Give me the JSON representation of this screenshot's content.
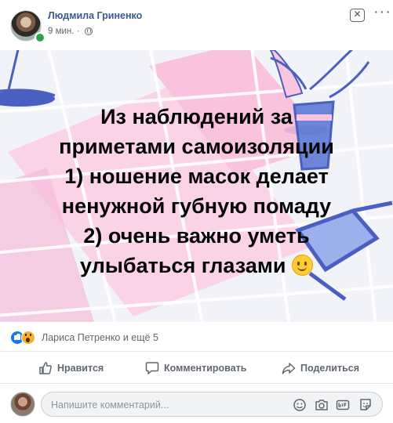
{
  "post": {
    "author": "Людмила Гриненко",
    "time": "9 мин.",
    "separator": "·",
    "close_glyph": "✕",
    "menu_glyph": "···",
    "text_lines": [
      "Из наблюдений за",
      "приметами самоизоляции",
      "1) ношение масок делает",
      "ненужной губную помаду",
      "2) очень важно уметь",
      "улыбаться глазами"
    ],
    "emoji": "slightly-smiling-face"
  },
  "reactions": {
    "icons": [
      "like-icon",
      "wow-icon"
    ],
    "text": "Лариса Петренко и ещё 5"
  },
  "actions": {
    "like": "Нравится",
    "comment": "Комментировать",
    "share": "Поделиться"
  },
  "comment": {
    "placeholder": "Напишите комментарий..."
  },
  "colors": {
    "author_link": "#385898",
    "like_blue": "#1877f2",
    "wow_yellow": "#f7b125",
    "online_green": "#31a24c",
    "grid_blue": "#4a5fc1",
    "pink": "#fbc5e0"
  }
}
